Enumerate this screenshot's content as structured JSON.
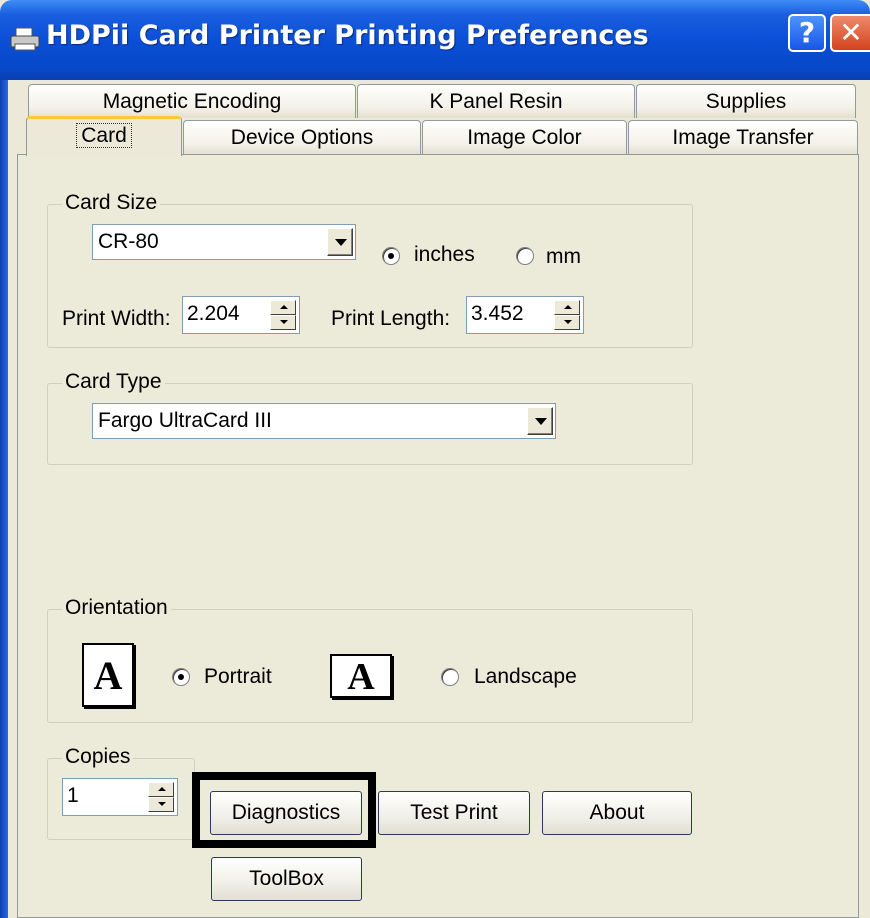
{
  "window": {
    "title": "HDPii Card Printer Printing Preferences",
    "help_glyph": "?",
    "close_glyph": "✕"
  },
  "tabs": {
    "row_back": [
      "Magnetic Encoding",
      "K Panel Resin",
      "Supplies"
    ],
    "row_front": [
      "Card",
      "Device Options",
      "Image Color",
      "Image Transfer"
    ],
    "active": "Card"
  },
  "card_size": {
    "group_label": "Card Size",
    "selected": "CR-80",
    "units": [
      {
        "label": "inches",
        "selected": true
      },
      {
        "label": "mm",
        "selected": false
      }
    ],
    "print_width_label": "Print Width:",
    "print_width_value": "2.204",
    "print_length_label": "Print Length:",
    "print_length_value": "3.452"
  },
  "card_type": {
    "group_label": "Card Type",
    "selected": "Fargo UltraCard III"
  },
  "orientation": {
    "group_label": "Orientation",
    "icon_glyph": "A",
    "options": [
      {
        "label": "Portrait",
        "selected": true
      },
      {
        "label": "Landscape",
        "selected": false
      }
    ]
  },
  "copies": {
    "group_label": "Copies",
    "value": "1"
  },
  "buttons": {
    "diagnostics": "Diagnostics",
    "test_print": "Test Print",
    "about": "About",
    "toolbox": "ToolBox"
  },
  "colors": {
    "titlebar": "#0a4fd6",
    "face": "#ece9d8",
    "tab_highlight": "#ffc73c",
    "close": "#d3431e"
  }
}
